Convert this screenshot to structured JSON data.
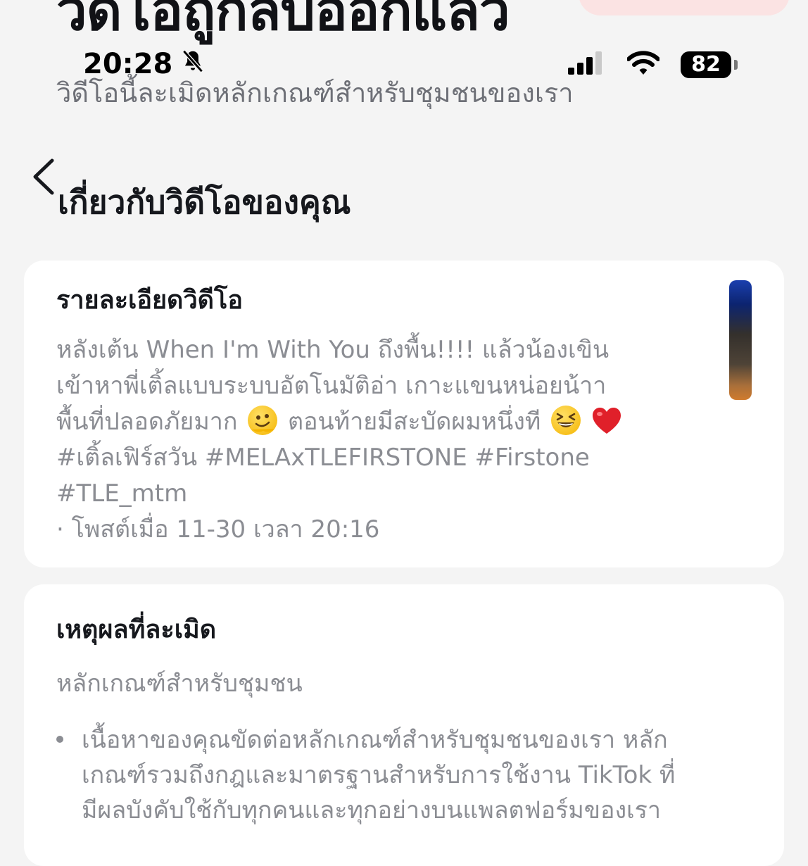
{
  "header": {
    "title": "วิดีโอถูกลบออกแล้ว",
    "subtitle": "วิดีโอนี้ละเมิดหลักเกณฑ์สำหรับชุมชนของเรา"
  },
  "status_bar": {
    "time": "20:28",
    "battery": "82",
    "icons": [
      "bell-muted-icon",
      "cellular-signal-icon",
      "wifi-icon",
      "battery-icon"
    ]
  },
  "nav": {
    "back_icon": "chevron-left-icon"
  },
  "section": {
    "title": "เกี่ยวกับวิดีโอของคุณ"
  },
  "video_details": {
    "heading": "รายละเอียดวิดีโอ",
    "lines": [
      "หลังเต้น When I'm With You ถึงพื้น!!!! แล้วน้องเขิน",
      "เข้าหาพี่เติ้ลแบบระบบอัตโนมัติอ่า เกาะแขนหน่อยน้าา",
      "พื้นที่ปลอดภัยมาก",
      "ตอนท้ายมีสะบัดผมหนึ่งที",
      "#เติ้ลเฟิร์สวัน #MELAxTLEFIRSTONE #Firstone",
      "#TLE_mtm",
      "· โพสต์เมื่อ 11-30 เวลา 20:16"
    ],
    "emojis": [
      "melting-face-emoji",
      "grinning-squinting-face-emoji",
      "red-heart-emoji"
    ]
  },
  "violation": {
    "heading": "เหตุผลที่ละเมิด",
    "category": "หลักเกณฑ์สำหรับชุมชน",
    "bullet_lines": [
      "เนื้อหาของคุณขัดต่อหลักเกณฑ์สำหรับชุมชนของเรา หลัก",
      "เกณฑ์รวมถึงกฎและมาตรฐานสำหรับการใช้งาน TikTok ที่",
      "มีผลบังคับใช้กับทุกคนและทุกอย่างบนแพลตฟอร์มของเรา"
    ]
  },
  "colors": {
    "background": "#f4f4f4",
    "card": "#ffffff",
    "primary_text": "#16181d",
    "secondary_text": "#8b8d93",
    "top_tab": "#fbe3e3"
  }
}
